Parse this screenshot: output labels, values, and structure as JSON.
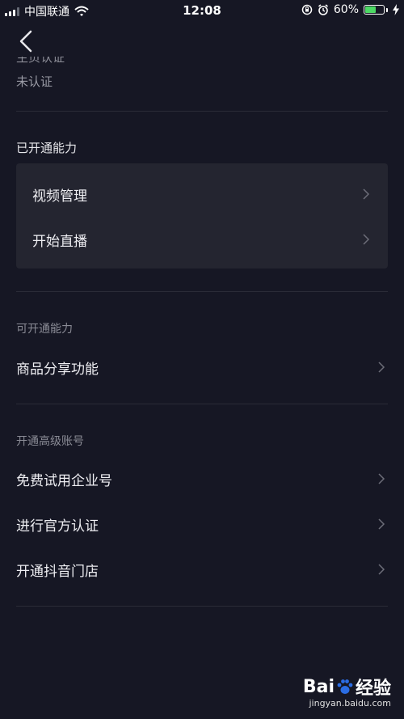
{
  "status_bar": {
    "carrier": "中国联通",
    "time": "12:08",
    "battery_percent": "60%",
    "battery_level": 0.6,
    "accent": "#4cd964"
  },
  "back_icon": "chevron-left-icon",
  "partial_text": "主页认证",
  "cert_status": "未认证",
  "enabled_section": {
    "title": "已开通能力",
    "items": [
      {
        "label": "视频管理"
      },
      {
        "label": "开始直播"
      }
    ]
  },
  "available_section": {
    "title": "可开通能力",
    "items": [
      {
        "label": "商品分享功能"
      }
    ]
  },
  "advanced_section": {
    "title": "开通高级账号",
    "items": [
      {
        "label": "免费试用企业号"
      },
      {
        "label": "进行官方认证"
      },
      {
        "label": "开通抖音门店"
      }
    ]
  },
  "watermark": {
    "brand_a": "Bai",
    "brand_b": "经验",
    "url": "jingyan.baidu.com"
  },
  "colors": {
    "background": "#161724",
    "card": "#242530",
    "divider": "#2a2b37"
  }
}
